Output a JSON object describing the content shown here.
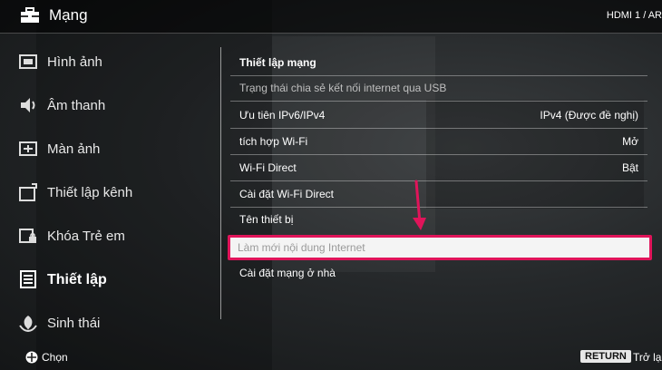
{
  "header": {
    "title": "Mạng",
    "title_icon": "toolbox-icon",
    "source": "HDMI 1 / AR"
  },
  "sidebar": {
    "items": [
      {
        "label": "Hình ảnh",
        "icon": "picture-icon"
      },
      {
        "label": "Âm thanh",
        "icon": "speaker-icon"
      },
      {
        "label": "Màn ảnh",
        "icon": "screen-icon"
      },
      {
        "label": "Thiết lập kênh",
        "icon": "channel-setup-icon"
      },
      {
        "label": "Khóa Trẻ em",
        "icon": "child-lock-icon"
      },
      {
        "label": "Thiết lập",
        "icon": "settings-icon",
        "active": true
      },
      {
        "label": "Sinh thái",
        "icon": "eco-icon"
      }
    ]
  },
  "menu": {
    "items": [
      {
        "label": "Thiết lập mạng",
        "value": ""
      },
      {
        "label": "Trạng thái chia sẻ kết nối internet qua USB",
        "value": ""
      },
      {
        "label": "Ưu tiên IPv6/IPv4",
        "value": "IPv4 (Được đề nghị)"
      },
      {
        "label": "tích hợp Wi-Fi",
        "value": "Mở"
      },
      {
        "label": "Wi-Fi Direct",
        "value": "Bật"
      },
      {
        "label": "Cài đặt Wi-Fi Direct",
        "value": ""
      },
      {
        "label": "Tên thiết bị",
        "value": ""
      },
      {
        "label": "Làm mới nội dung Internet",
        "value": "",
        "selected": true
      },
      {
        "label": "Cài đặt mạng ở nhà",
        "value": ""
      }
    ]
  },
  "footer": {
    "choose_label": "Chọn",
    "return_key": "RETURN",
    "return_label": "Trở lại"
  },
  "colors": {
    "highlight_border": "#e0145a",
    "arrow": "#e0145a"
  }
}
